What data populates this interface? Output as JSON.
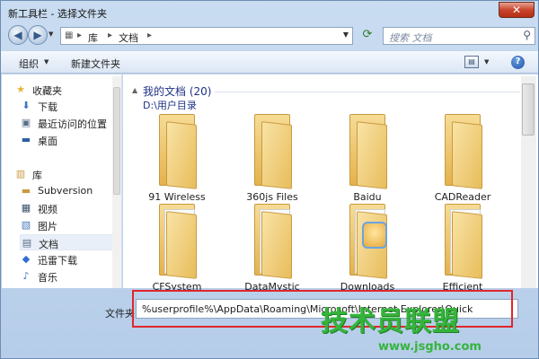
{
  "window": {
    "title": "新工具栏 - 选择文件夹",
    "close_label": "✕"
  },
  "navigation": {
    "back_icon": "back-arrow-icon",
    "forward_icon": "forward-arrow-icon",
    "address": {
      "separator": "▸",
      "crumbs": [
        "库",
        "文档"
      ]
    },
    "search_placeholder": "搜索 文档"
  },
  "toolbar": {
    "organize_label": "组织",
    "new_folder_label": "新建文件夹"
  },
  "sidebar": {
    "favorites": {
      "label": "收藏夹",
      "items": [
        "下载",
        "最近访问的位置",
        "桌面"
      ]
    },
    "libraries": {
      "label": "库",
      "items": [
        "Subversion",
        "视频",
        "图片",
        "文档",
        "迅雷下载",
        "音乐"
      ],
      "selected": "文档"
    }
  },
  "content": {
    "group_title": "我的文档 (20)",
    "group_path": "D:\\用户目录",
    "folders": [
      "91 Wireless",
      "360js Files",
      "Baidu",
      "CADReader",
      "CFSystem",
      "DataMystic",
      "Downloads",
      "Efficient"
    ]
  },
  "bottom": {
    "folder_label": "文件夹",
    "folder_value": "%userprofile%\\AppData\\Roaming\\Microsoft\\Internet Explorer\\Quick"
  },
  "watermark": {
    "text": "技术员联盟",
    "url": "www.jsgho.com"
  },
  "colors": {
    "highlight": "#e0262a",
    "folder": "#e8bd5c",
    "link_blue": "#1e3287",
    "watermark": "#35b43c"
  }
}
